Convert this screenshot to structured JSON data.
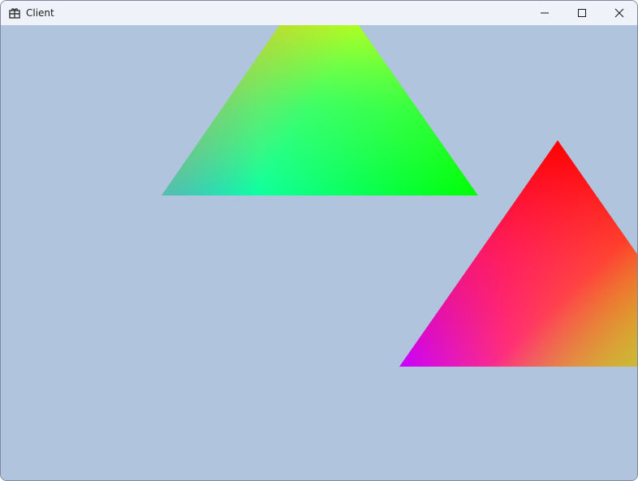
{
  "window": {
    "title": "Client",
    "icons": {
      "app": "app-icon",
      "minimize": "minimize-icon",
      "maximize": "maximize-icon",
      "close": "close-icon"
    }
  },
  "scene": {
    "clear_color": "#b0c4de",
    "triangles": [
      {
        "name": "triangle-green",
        "vertex_colors": {
          "top": "#ffff00",
          "left": "#00c8ff",
          "right": "#00ff00"
        }
      },
      {
        "name": "triangle-red",
        "vertex_colors": {
          "top": "#ff0000",
          "left": "#c800ff",
          "right": "#ffaa00"
        }
      }
    ]
  }
}
